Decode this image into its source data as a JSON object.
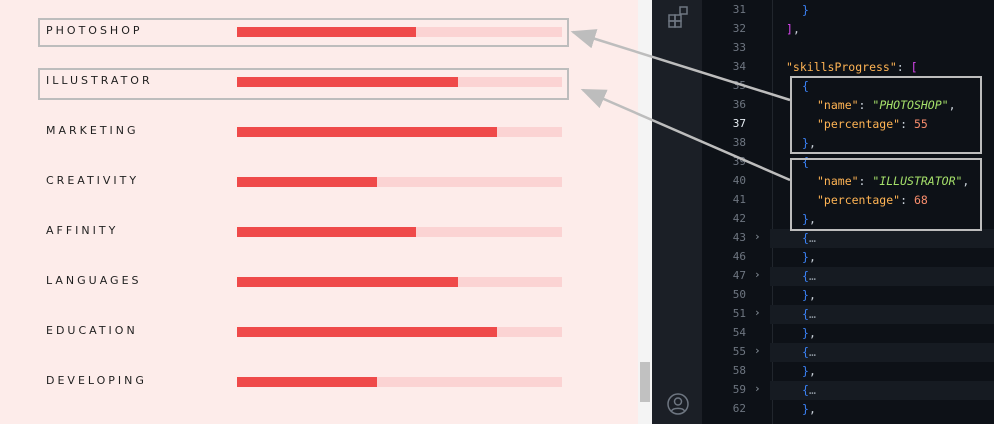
{
  "skills": [
    {
      "name": "PHOTOSHOP",
      "percentage": 55
    },
    {
      "name": "ILLUSTRATOR",
      "percentage": 68
    },
    {
      "name": "MARKETING",
      "percentage": 80
    },
    {
      "name": "CREATIVITY",
      "percentage": 43
    },
    {
      "name": "AFFINITY",
      "percentage": 55
    },
    {
      "name": "LANGUAGES",
      "percentage": 68
    },
    {
      "name": "EDUCATION",
      "percentage": 80
    },
    {
      "name": "DEVELOPING",
      "percentage": 43
    }
  ],
  "colors": {
    "bar_fill": "#ef4a4a",
    "bar_track": "#fbd3d3",
    "preview_bg": "#fdecea",
    "editor_bg": "#0d1117",
    "highlight": "#bdbdbd"
  },
  "activity_bar": {
    "icons": [
      "extensions-icon",
      "account-icon"
    ]
  },
  "editor": {
    "active_line": "37",
    "line_numbers": [
      "31",
      "32",
      "33",
      "34",
      "35",
      "36",
      "37",
      "38",
      "39",
      "40",
      "41",
      "42",
      "43",
      "46",
      "47",
      "50",
      "51",
      "54",
      "55",
      "58",
      "59",
      "62"
    ],
    "code": {
      "l31": "}",
      "l32_bracket": "]",
      "l32_comma": ",",
      "l34_key": "\"skillsProgress\"",
      "l34_colon": ": ",
      "l34_bracket": "[",
      "open_brace": "{",
      "close_brace": "}",
      "comma": ",",
      "key_name": "\"name\"",
      "key_percentage": "\"percentage\"",
      "colon": ": ",
      "val_photoshop": "\"PHOTOSHOP\"",
      "val_illustrator": "\"ILLUSTRATOR\"",
      "num_55": "55",
      "num_68": "68",
      "ellipsis": "…"
    }
  }
}
